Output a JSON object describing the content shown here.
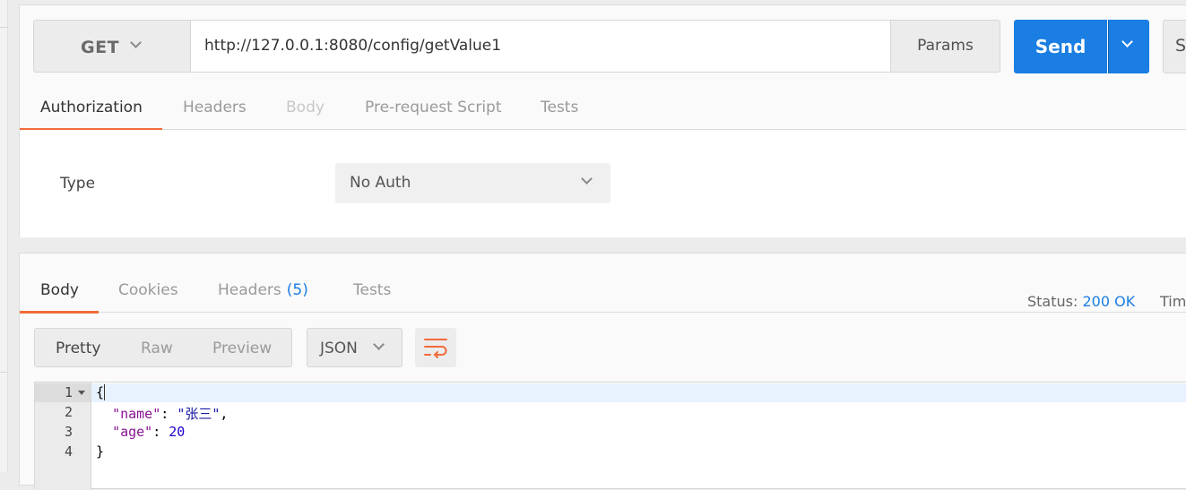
{
  "request": {
    "method": "GET",
    "url": "http://127.0.0.1:8080/config/getValue1",
    "params_label": "Params",
    "send_label": "Send",
    "save_label_partial": "Sa",
    "tabs": [
      {
        "label": "Authorization",
        "state": "active"
      },
      {
        "label": "Headers",
        "state": "normal"
      },
      {
        "label": "Body",
        "state": "disabled"
      },
      {
        "label": "Pre-request Script",
        "state": "normal"
      },
      {
        "label": "Tests",
        "state": "normal"
      }
    ],
    "auth": {
      "type_label": "Type",
      "type_value": "No Auth"
    }
  },
  "response": {
    "tabs": [
      {
        "label": "Body",
        "state": "active"
      },
      {
        "label": "Cookies",
        "state": "normal"
      },
      {
        "label": "Headers",
        "badge": "(5)",
        "state": "normal"
      },
      {
        "label": "Tests",
        "state": "normal"
      }
    ],
    "status_label": "Status:",
    "status_value": "200 OK",
    "time_label_partial": "Tim",
    "view_modes": [
      "Pretty",
      "Raw",
      "Preview"
    ],
    "active_view": "Pretty",
    "format": "JSON",
    "wrap_icon": "wrap-lines-icon",
    "body_lines": [
      {
        "num": "1",
        "text": "{"
      },
      {
        "num": "2",
        "key": "\"name\"",
        "value": "\"张三\""
      },
      {
        "num": "3",
        "key": "\"age\"",
        "value": "20"
      },
      {
        "num": "4",
        "text": "}"
      }
    ]
  },
  "colors": {
    "accent_orange": "#f26b3a",
    "primary_blue": "#1a7ee3"
  }
}
